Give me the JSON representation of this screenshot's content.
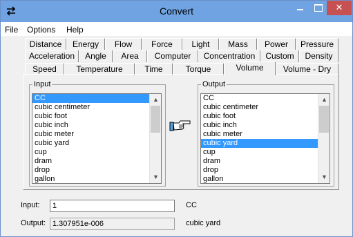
{
  "window": {
    "title": "Convert",
    "close_glyph": "✕"
  },
  "menu": [
    "File",
    "Options",
    "Help"
  ],
  "tabs_row1": [
    "Distance",
    "Energy",
    "Flow",
    "Force",
    "Light",
    "Mass",
    "Power",
    "Pressure"
  ],
  "tabs_row2": [
    "Acceleration",
    "Angle",
    "Area",
    "Computer",
    "Concentration",
    "Custom",
    "Density"
  ],
  "tabs_row3": [
    "Speed",
    "Temperature",
    "Time",
    "Torque",
    "Volume",
    "Volume - Dry"
  ],
  "active_tab": "Volume",
  "input_group": {
    "label": "Input",
    "items": [
      "CC",
      "cubic centimeter",
      "cubic foot",
      "cubic inch",
      "cubic meter",
      "cubic yard",
      "cup",
      "dram",
      "drop",
      "gallon"
    ],
    "selected": "CC"
  },
  "output_group": {
    "label": "Output",
    "items": [
      "CC",
      "cubic centimeter",
      "cubic foot",
      "cubic inch",
      "cubic meter",
      "cubic yard",
      "cup",
      "dram",
      "drop",
      "gallon"
    ],
    "selected": "cubic yard"
  },
  "arrows": {
    "up": "▲",
    "down": "▼"
  },
  "input": {
    "label": "Input:",
    "value": "1",
    "unit": "CC"
  },
  "output": {
    "label": "Output:",
    "value": "1.307951e-006",
    "unit": "cubic yard"
  },
  "colors": {
    "selection": "#3399ff",
    "titlebar": "#6fa3e1",
    "close": "#c75050"
  },
  "icons": {
    "app": "swap-arrows-icon",
    "convert": "pointing-hand-icon"
  }
}
